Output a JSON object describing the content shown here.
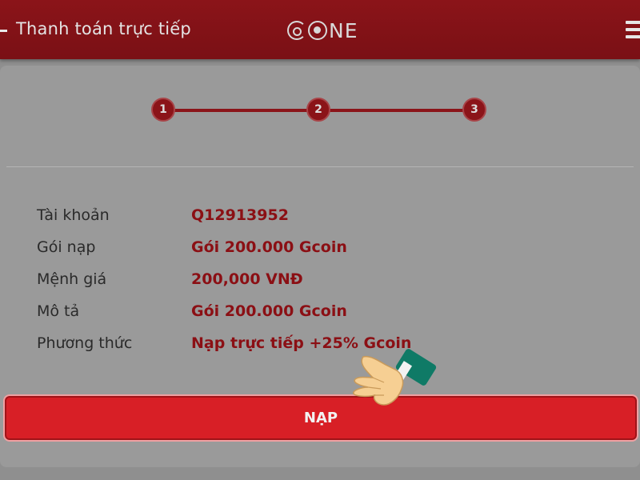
{
  "header": {
    "title": "Thanh toán trực tiếp",
    "logo_text": "NE",
    "back_icon": "back-arrow-icon",
    "menu_icon": "hamburger-menu-icon"
  },
  "stepper": {
    "steps": [
      "1",
      "2",
      "3"
    ],
    "active_color": "#8b1419"
  },
  "details": [
    {
      "label": "Tài khoản",
      "value": "Q12913952"
    },
    {
      "label": "Gói nạp",
      "value": "Gói 200.000 Gcoin"
    },
    {
      "label": "Mệnh giá",
      "value": "200,000 VNĐ"
    },
    {
      "label": "Mô tả",
      "value": "Gói 200.000 Gcoin"
    },
    {
      "label": "Phương thức",
      "value": "Nạp trực tiếp +25% Gcoin"
    }
  ],
  "action": {
    "submit_label": "NẠP",
    "pointer_icon": "pointing-hand-icon"
  },
  "colors": {
    "brand": "#8b1419",
    "button": "#d81f26",
    "value_text": "#8b0f14"
  }
}
